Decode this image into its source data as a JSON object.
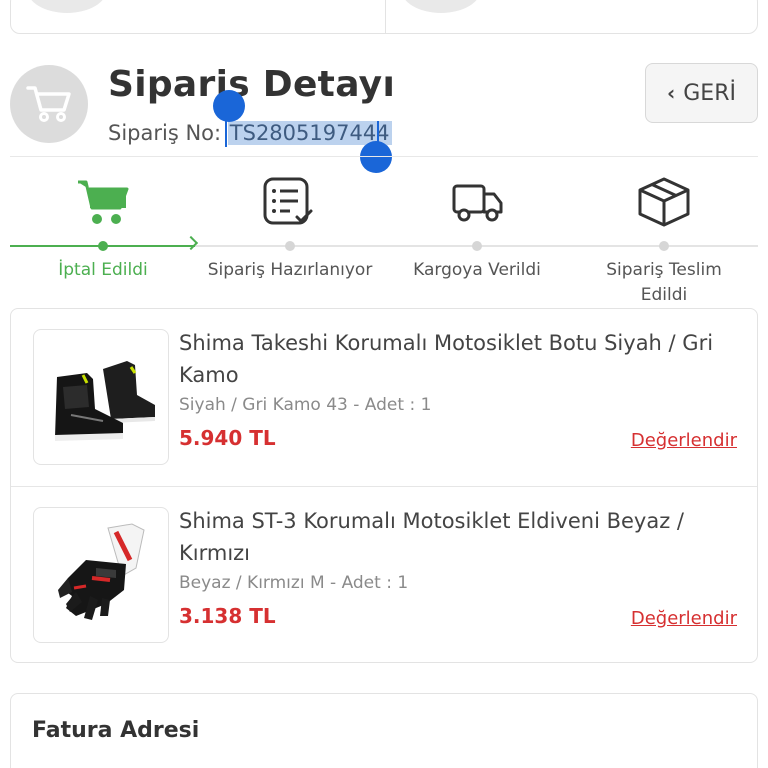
{
  "header": {
    "title": "Sipariş Detayı",
    "order_label": "Sipariş No:",
    "order_number": "TS2805197444",
    "back_label": "GERİ"
  },
  "steps": [
    {
      "label": "İptal Edildi",
      "icon": "cart-icon",
      "active": true
    },
    {
      "label": "Sipariş Hazırlanıyor",
      "icon": "checklist-icon",
      "active": false
    },
    {
      "label": "Kargoya Verildi",
      "icon": "truck-icon",
      "active": false
    },
    {
      "label": "Sipariş Teslim Edildi",
      "icon": "box-icon",
      "active": false
    }
  ],
  "products": [
    {
      "name": "Shima Takeshi Korumalı Motosiklet Botu Siyah / Gri Kamo",
      "variant": "Siyah / Gri Kamo 43 - Adet : 1",
      "price": "5.940 TL",
      "rate_label": "Değerlendir",
      "image": "boots-image"
    },
    {
      "name": "Shima ST-3 Korumalı Motosiklet Eldiveni Beyaz / Kırmızı",
      "variant": "Beyaz / Kırmızı M - Adet : 1",
      "price": "3.138 TL",
      "rate_label": "Değerlendir",
      "image": "gloves-image"
    }
  ],
  "billing": {
    "title": "Fatura Adresi"
  },
  "colors": {
    "accent_green": "#4caf50",
    "price_red": "#d63031",
    "selection_blue": "#1a66d8"
  }
}
